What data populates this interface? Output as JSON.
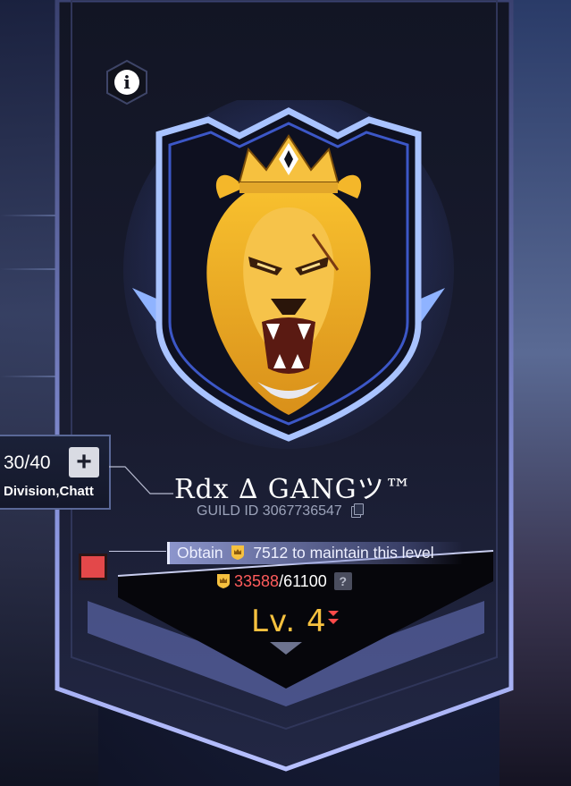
{
  "guild": {
    "name": "Rdx ∆ GANGツ™",
    "id_label": "GUILD ID",
    "id_value": "3067736547"
  },
  "members": {
    "count": "30/40",
    "tags": "Division,Chatt"
  },
  "level": {
    "requirement_prefix": "Obtain",
    "requirement_amount": "7512",
    "requirement_suffix": "to maintain this level",
    "points_current": "33588",
    "points_max": "/61100",
    "help_label": "?",
    "label": "Lv. 4"
  },
  "icons": {
    "info": "info-icon",
    "add": "plus-icon",
    "copy": "copy-icon",
    "crown": "crown-badge-icon",
    "help": "question-icon",
    "emblem": "lion-king-emblem",
    "level_down": "double-chevron-down-icon"
  },
  "colors": {
    "accent_gold": "#f6c13f",
    "current_points_red": "#ff5c5c",
    "banner_border": "#7f8cd6"
  }
}
